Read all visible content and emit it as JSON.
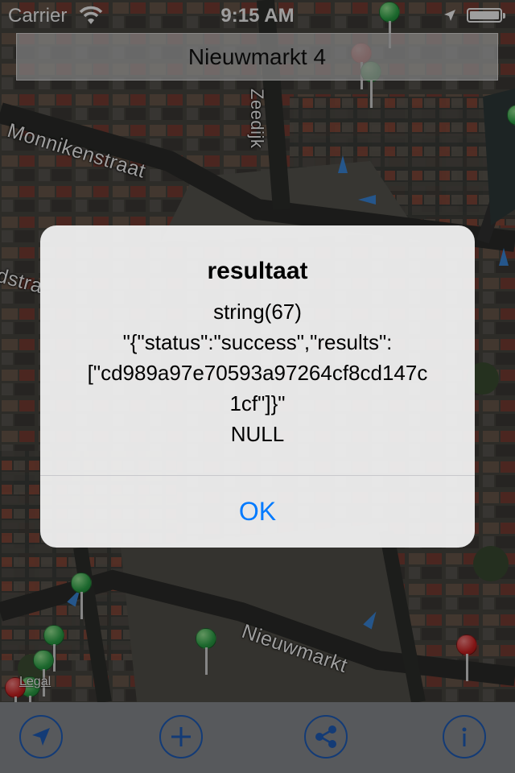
{
  "status_bar": {
    "carrier": "Carrier",
    "time": "9:15 AM"
  },
  "address_bar": {
    "text": "Nieuwmarkt 4"
  },
  "map": {
    "streets": {
      "monnikenstraat": "Monnikenstraat",
      "zeedijk": "Zeedijk",
      "nieuwmarkt": "Nieuwmarkt",
      "partial_left": "dstra"
    },
    "legal": "Legal"
  },
  "alert": {
    "title": "resultaat",
    "message": "string(67)\n\"{\"status\":\"success\",\"results\":\n[\"cd989a97e70593a97264cf8cd147c\n1cf\"]}\"\nNULL",
    "ok_button": "OK"
  },
  "toolbar": {
    "buttons": [
      {
        "icon": "location-arrow-icon"
      },
      {
        "icon": "plus-icon"
      },
      {
        "icon": "share-icon"
      },
      {
        "icon": "info-icon"
      }
    ],
    "accent_color": "#1f5fbf"
  },
  "colors": {
    "alert_button": "#007aff",
    "pin_green": "#2ea84a",
    "pin_red": "#d32424"
  }
}
